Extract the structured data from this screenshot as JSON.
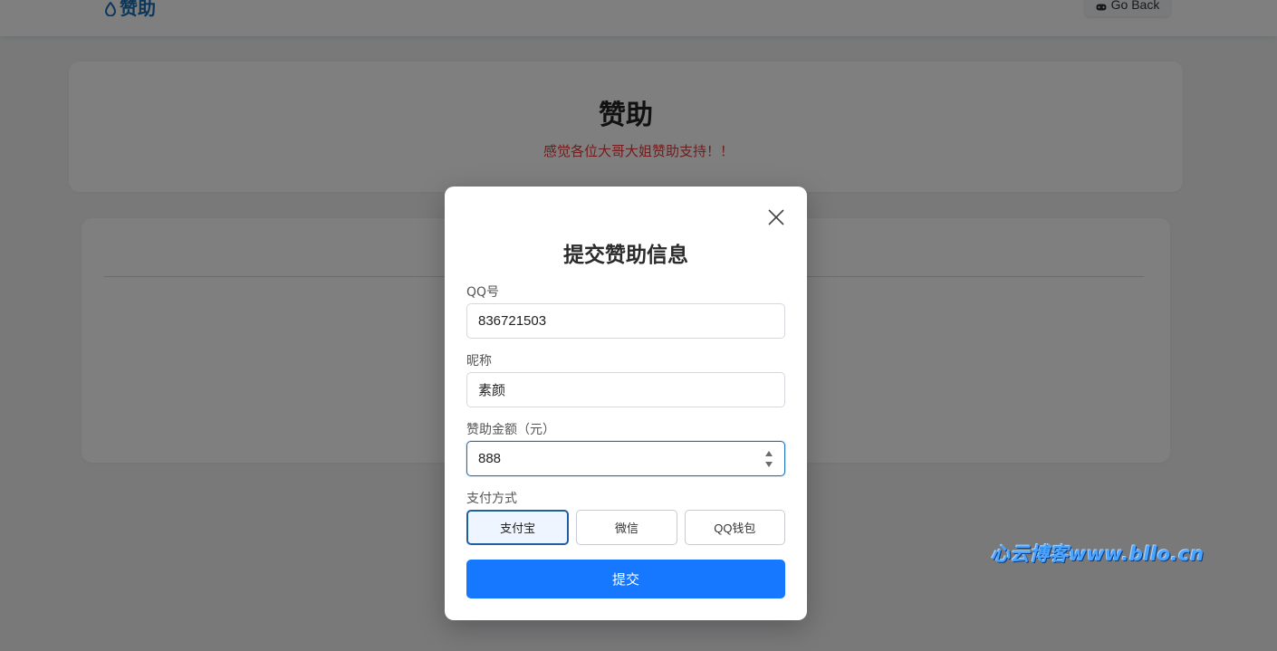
{
  "header": {
    "brand_text": "赞助",
    "go_back_label": "Go Back"
  },
  "hero": {
    "title": "赞助",
    "subtitle": "感觉各位大哥大姐赞助支持！！"
  },
  "modal": {
    "title": "提交赞助信息",
    "fields": {
      "qq": {
        "label": "QQ号",
        "value": "836721503"
      },
      "nickname": {
        "label": "昵称",
        "value": "素颜"
      },
      "amount": {
        "label": "赞助金额（元）",
        "value": "888"
      }
    },
    "payment": {
      "label": "支付方式",
      "options": [
        "支付宝",
        "微信",
        "QQ钱包"
      ],
      "selected": "支付宝"
    },
    "submit_label": "提交"
  },
  "watermark": "心云博客www.bllo.cn",
  "colors": {
    "brand": "#1a6fb5",
    "accent": "#1677ff",
    "subtitle_red": "#e23b3b",
    "selected_border": "#1f5fa0"
  },
  "icons": {
    "brand": "droplet-icon",
    "go_back": "gamepad-icon",
    "close": "close-icon",
    "stepper": "stepper-arrows-icon"
  }
}
